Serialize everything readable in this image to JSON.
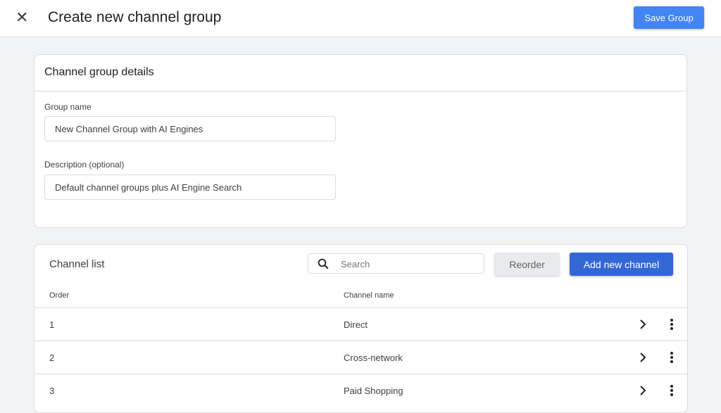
{
  "header": {
    "title": "Create new channel group",
    "save_label": "Save Group"
  },
  "details": {
    "title": "Channel group details",
    "group_name_label": "Group name",
    "group_name_value": "New Channel Group with AI Engines",
    "description_label": "Description (optional)",
    "description_value": "Default channel groups plus AI Engine Search"
  },
  "channel_list": {
    "title": "Channel list",
    "search_placeholder": "Search",
    "reorder_label": "Reorder",
    "add_label": "Add new channel",
    "columns": [
      "Order",
      "Channel name"
    ],
    "rows": [
      {
        "order": "1",
        "name": "Direct"
      },
      {
        "order": "2",
        "name": "Cross-network"
      },
      {
        "order": "3",
        "name": "Paid Shopping"
      }
    ]
  },
  "colors": {
    "primary": "#4285f4",
    "add_button": "#3367d6",
    "background": "#f1f3f4"
  }
}
